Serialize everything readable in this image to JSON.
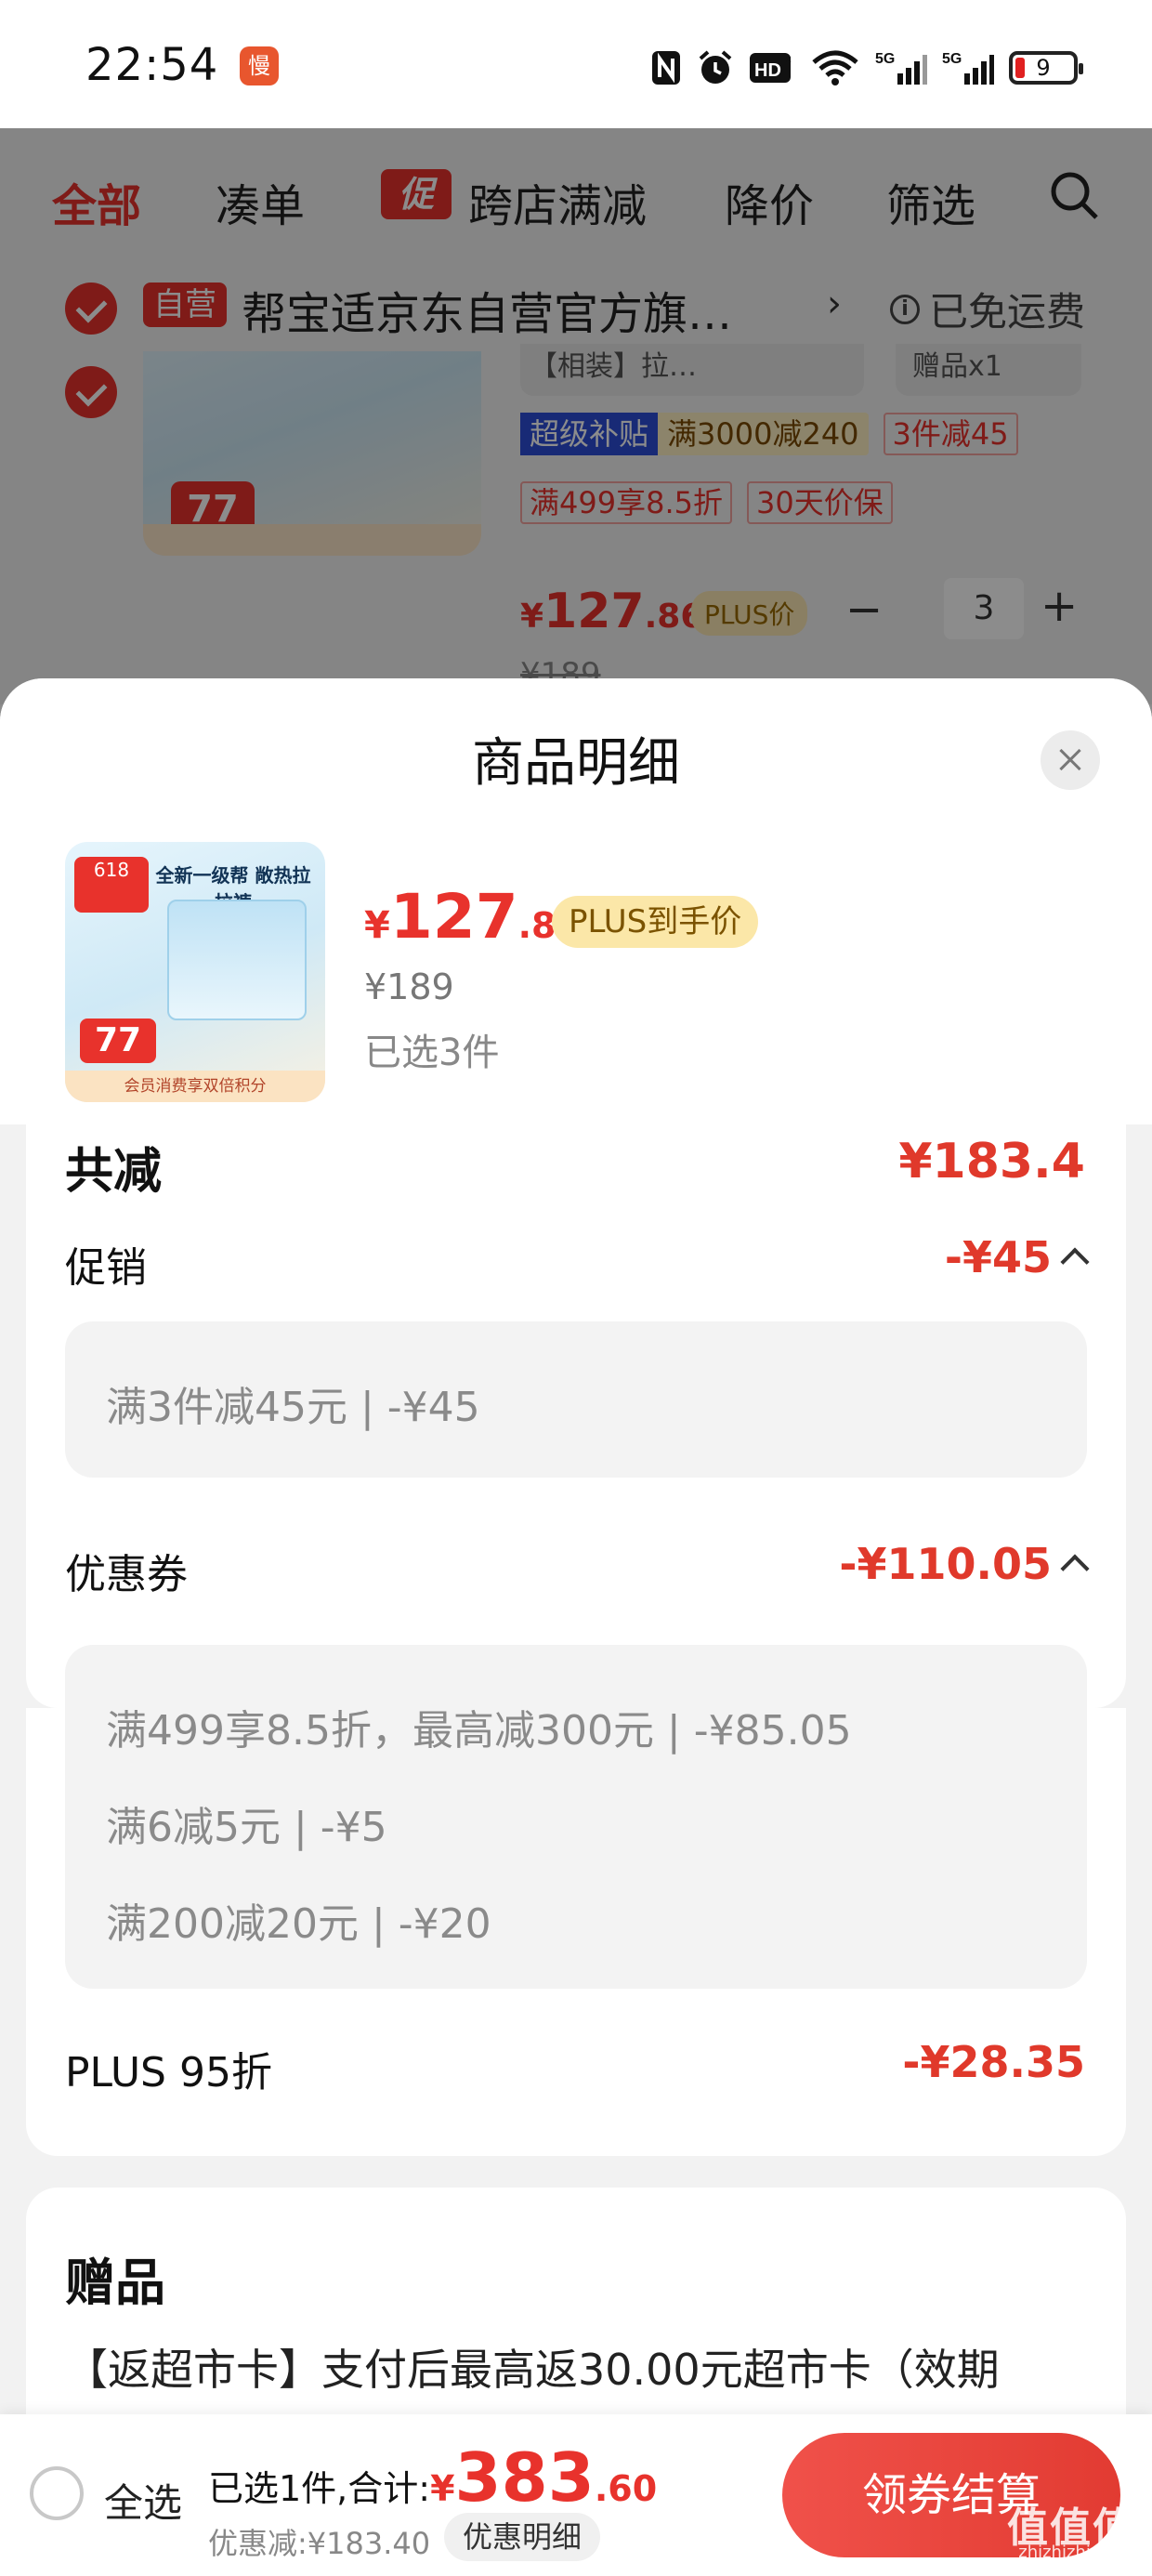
{
  "status_bar": {
    "time": "22:54",
    "app_icon_glyph": "慢",
    "icons": [
      "nfc-icon",
      "alarm-icon",
      "hd-icon",
      "wifi-icon",
      "5g-signal-icon",
      "5g-signal-icon",
      "battery-icon"
    ],
    "hd_label": "HD",
    "signal_label_1": "5G",
    "signal_label_2": "5G",
    "battery_level": "9"
  },
  "background": {
    "filters": [
      "全部",
      "凑单",
      "跨店满减",
      "降价",
      "筛选"
    ],
    "promo_tag": "促",
    "shop": {
      "self_tag": "自营",
      "name": "帮宝适京东自营官方旗…",
      "shipping": "已免运费"
    },
    "item_tags_top": [
      "【相装】拉…",
      "赠品x1"
    ],
    "super_label": "超级补贴",
    "super_value": "满3000减240",
    "tags": [
      "3件减45",
      "满499享8.5折",
      "30天价保"
    ],
    "price_symbol": "¥",
    "price_int": "127",
    "price_dec": ".86",
    "plus_label": "PLUS价",
    "quantity": "3",
    "old_price": "¥189",
    "thumb_badge": "77"
  },
  "sheet": {
    "title": "商品明细",
    "product": {
      "price_symbol": "¥",
      "price_int": "127",
      "price_dec": ".86",
      "plus_badge": "PLUS到手价",
      "old_price": "¥189",
      "selected": "已选3件",
      "img_badge": "77",
      "img_headline": "全新一级帮 敞热拉拉裤",
      "img_strip": "会员消费享双倍积分"
    },
    "total_reduction": {
      "label": "共减",
      "value": "¥183.4"
    },
    "promotion": {
      "label": "促销",
      "value": "-¥45",
      "details": [
        "满3件减45元 | -¥45"
      ]
    },
    "coupons": {
      "label": "优惠券",
      "value": "-¥110.05",
      "details": [
        "满499享8.5折，最高减300元 | -¥85.05",
        "满6减5元 | -¥5",
        "满200减20元 | -¥20"
      ]
    },
    "plus": {
      "label": "PLUS 95折",
      "value": "-¥28.35"
    },
    "gifts": {
      "title": "赠品",
      "text": "【返超市卡】支付后最高返30.00元超市卡（效期"
    }
  },
  "bottom_bar": {
    "select_all": "全选",
    "summary_label": "已选1件,合计:",
    "total_symbol": "¥",
    "total_int": "383",
    "total_dec": ".60",
    "discount": "优惠减:¥183.40",
    "detail_link": "优惠明细",
    "checkout": "领券结算",
    "watermark": "值值值",
    "watermark_sub": "zhizhizhi.com"
  },
  "colors": {
    "accent_red": "#e8322c",
    "value_red": "#e0392b",
    "plus_gold": "#fbe7a8",
    "sheet_bg": "#f2f2f2"
  }
}
